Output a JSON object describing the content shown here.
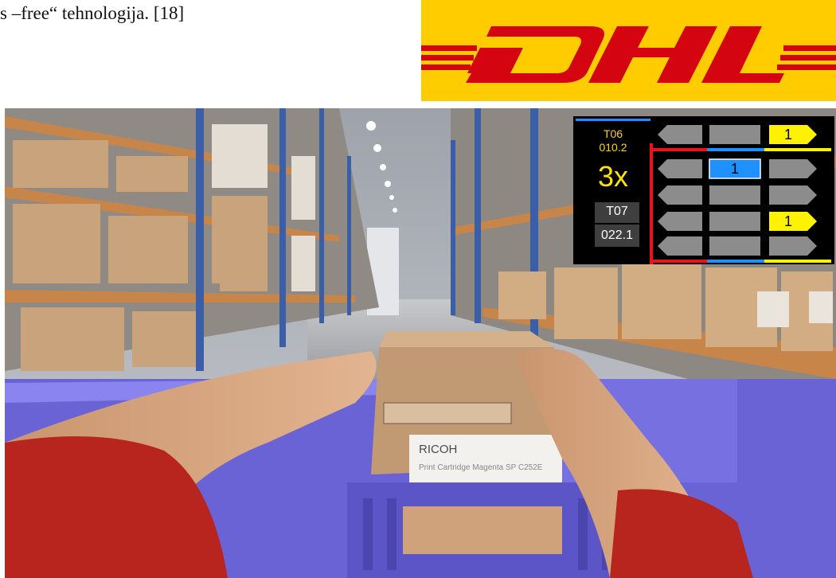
{
  "caption": "s –free“ tehnologija. [18]",
  "logo": {
    "name": "DHL",
    "background": "#ffcc00",
    "color": "#d40511"
  },
  "hud": {
    "current_location": {
      "line1": "T06",
      "line2": "010.2"
    },
    "quantity": "3x",
    "next_location": {
      "line1": "T07",
      "line2": "022.1"
    },
    "colors": {
      "target_yellow": "#fff200",
      "target_blue": "#1e90ff",
      "slot_gray": "#8c8c8c",
      "divider_red": "#e8141c"
    },
    "slots": [
      {
        "row": 1,
        "col": 3,
        "label": "1",
        "color": "yellow"
      },
      {
        "row": 2,
        "col": 2,
        "label": "1",
        "color": "blue"
      },
      {
        "row": 4,
        "col": 3,
        "label": "1",
        "color": "yellow"
      }
    ]
  },
  "box_label": {
    "brand": "RICOH",
    "product": "Print Cartridge Magenta SP C252E"
  }
}
